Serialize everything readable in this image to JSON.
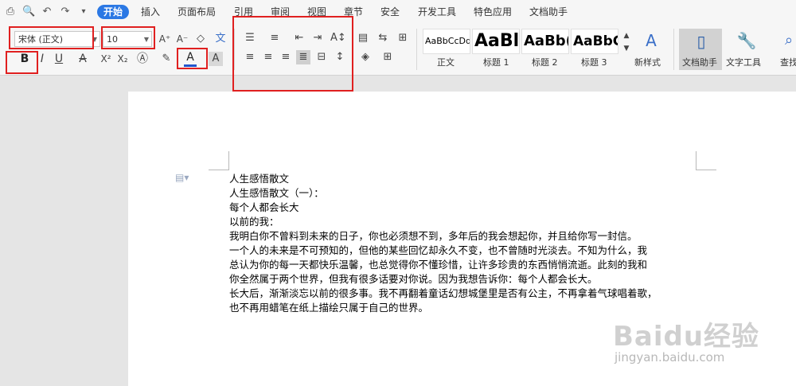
{
  "tabs": [
    {
      "label": "开始",
      "active": true
    },
    {
      "label": "插入"
    },
    {
      "label": "页面布局"
    },
    {
      "label": "引用"
    },
    {
      "label": "审阅"
    },
    {
      "label": "视图"
    },
    {
      "label": "章节"
    },
    {
      "label": "安全"
    },
    {
      "label": "开发工具"
    },
    {
      "label": "特色应用"
    },
    {
      "label": "文档助手"
    }
  ],
  "font": {
    "name": "宋体 (正文)",
    "size": "10"
  },
  "styles": [
    {
      "preview": "AaBbCcDd",
      "label": "正文"
    },
    {
      "preview": "AaBl",
      "label": "标题 1"
    },
    {
      "preview": "AaBb(",
      "label": "标题 2"
    },
    {
      "preview": "AaBbC",
      "label": "标题 3"
    }
  ],
  "ribbon_buttons": {
    "new_style": "新样式",
    "doc_assistant": "文档助手",
    "text_tools": "文字工具",
    "find": "查找"
  },
  "document": {
    "lines": [
      "人生感悟散文",
      "人生感悟散文（一）：",
      "每个人都会长大",
      "以前的我：",
      "我明白你不曾料到未来的日子，你也必须想不到，多年后的我会想起你，并且给你写一封信。",
      "一个人的未来是不可预知的，但他的某些回忆却永久不变，也不曾随时光淡去。不知为什么，我",
      "总认为你的每一天都快乐温馨，也总觉得你不懂珍惜，让许多珍贵的东西悄悄流逝。此刻的我和",
      "你全然属于两个世界，但我有很多话要对你说。因为我想告诉你：每个人都会长大。",
      "长大后，渐渐淡忘以前的很多事。我不再翻着童话幻想城堡里是否有公主，不再拿着气球唱着歌，",
      "也不再用蜡笔在纸上描绘只属于自己的世界。"
    ]
  },
  "watermark": {
    "logo": "Baidu经验",
    "url": "jingyan.baidu.com"
  },
  "colors": {
    "accent": "#2b78e4",
    "highlight_box": "#e02020",
    "font_color_bar": "#2255cc"
  }
}
